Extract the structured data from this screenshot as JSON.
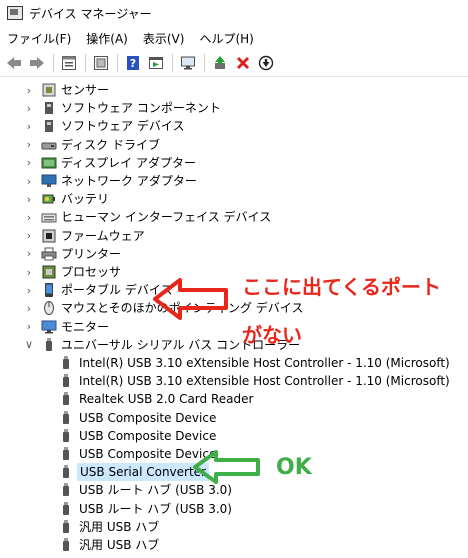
{
  "window": {
    "title": "デバイス マネージャー"
  },
  "menu": [
    "ファイル(F)",
    "操作(A)",
    "表示(V)",
    "ヘルプ(H)"
  ],
  "toolbar": {
    "icons": [
      "back-arrow-icon",
      "forward-arrow-icon",
      "properties-sheet-icon",
      "device-list-icon",
      "help-icon",
      "action-view-icon",
      "computer-monitor-icon",
      "update-driver-icon",
      "uninstall-x-icon",
      "disable-device-icon"
    ],
    "colors": {
      "uninstall": "#e02020",
      "update": "#2a9d3a",
      "help": "#2a52be"
    }
  },
  "tree": {
    "categories": [
      {
        "label": "センサー",
        "expanded": false
      },
      {
        "label": "ソフトウェア コンポーネント",
        "expanded": false
      },
      {
        "label": "ソフトウェア デバイス",
        "expanded": false
      },
      {
        "label": "ディスク ドライブ",
        "expanded": false
      },
      {
        "label": "ディスプレイ アダプター",
        "expanded": false
      },
      {
        "label": "ネットワーク アダプター",
        "expanded": false
      },
      {
        "label": "バッテリ",
        "expanded": false
      },
      {
        "label": "ヒューマン インターフェイス デバイス",
        "expanded": false
      },
      {
        "label": "ファームウェア",
        "expanded": false
      },
      {
        "label": "プリンター",
        "expanded": false
      },
      {
        "label": "プロセッサ",
        "expanded": false
      },
      {
        "label": "ポータブル デバイス",
        "expanded": false
      },
      {
        "label": "マウスとそのほかのポインティング デバイス",
        "expanded": false
      },
      {
        "label": "モニター",
        "expanded": false
      },
      {
        "label": "ユニバーサル シリアル バス コントローラー",
        "expanded": true
      }
    ],
    "usb_children": [
      {
        "label": "Intel(R) USB 3.10 eXtensible Host Controller - 1.10 (Microsoft)",
        "selected": false
      },
      {
        "label": "Intel(R) USB 3.10 eXtensible Host Controller - 1.10 (Microsoft)",
        "selected": false
      },
      {
        "label": "Realtek USB 2.0 Card Reader",
        "selected": false
      },
      {
        "label": "USB Composite Device",
        "selected": false
      },
      {
        "label": "USB Composite Device",
        "selected": false
      },
      {
        "label": "USB Composite Device",
        "selected": false
      },
      {
        "label": "USB Serial Converter",
        "selected": true
      },
      {
        "label": "USB ルート ハブ (USB 3.0)",
        "selected": false
      },
      {
        "label": "USB ルート ハブ (USB 3.0)",
        "selected": false
      },
      {
        "label": "汎用 USB ハブ",
        "selected": false
      },
      {
        "label": "汎用 USB ハブ",
        "selected": false
      }
    ]
  },
  "annotations": {
    "red_line1": "ここに出てくるポート",
    "red_line2": "がない",
    "green": "OK",
    "red_color": "#e8271b",
    "green_color": "#3fae49"
  }
}
